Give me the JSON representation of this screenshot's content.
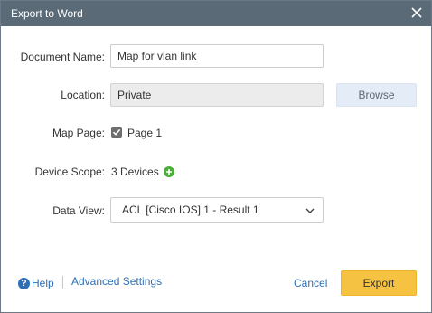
{
  "dialog": {
    "title": "Export to Word",
    "close_icon": "close-icon"
  },
  "form": {
    "document_name": {
      "label": "Document Name:",
      "value": "Map for vlan link"
    },
    "location": {
      "label": "Location:",
      "value": "Private",
      "browse_label": "Browse"
    },
    "map_page": {
      "label": "Map Page:",
      "checked": true,
      "option": "Page 1"
    },
    "device_scope": {
      "label": "Device Scope:",
      "value": "3 Devices",
      "add_icon": "plus-circle-icon"
    },
    "data_view": {
      "label": "Data View:",
      "selected": "ACL [Cisco IOS] 1 - Result 1",
      "chevron": "chevron-down-icon"
    }
  },
  "footer": {
    "help_label": "Help",
    "help_icon": "question-circle-icon",
    "advanced_label": "Advanced Settings",
    "cancel_label": "Cancel",
    "export_label": "Export"
  },
  "colors": {
    "titlebar": "#5b6a77",
    "link": "#2f6fb5",
    "primary_button": "#f5c242",
    "secondary_button": "#e4ecf7",
    "add_icon": "#4cae3a"
  }
}
